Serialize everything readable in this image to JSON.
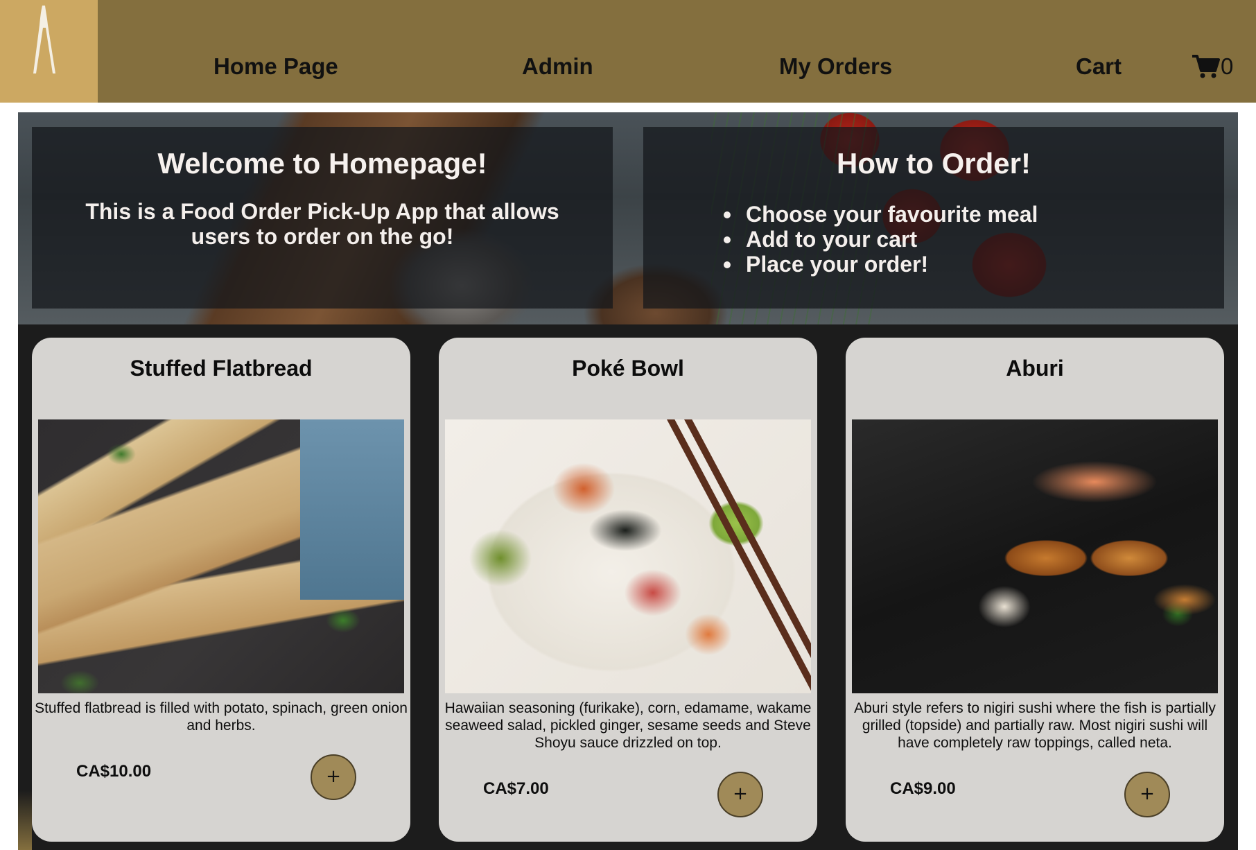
{
  "nav": {
    "logo_icon": "chopsticks-icon",
    "links": [
      {
        "label": "Home Page"
      },
      {
        "label": "Admin"
      },
      {
        "label": "My Orders"
      },
      {
        "label": "Cart"
      }
    ],
    "cart_icon": "cart-icon",
    "cart_count": "0",
    "colors": {
      "bar": "#846f3e",
      "logo_bg": "#cca862"
    }
  },
  "hero": {
    "welcome": {
      "title": "Welcome to Homepage!",
      "text": "This is a Food Order Pick-Up App that allows users to order on the go!"
    },
    "how_to": {
      "title": "How to Order!",
      "steps": [
        "Choose your favourite meal",
        "Add to your cart",
        "Place your order!"
      ]
    }
  },
  "products": [
    {
      "name": "Stuffed Flatbread",
      "description": "Stuffed flatbread is filled with potato, spinach, green onion and herbs.",
      "price": "CA$10.00",
      "add_label": "+"
    },
    {
      "name": "Poké Bowl",
      "description": "Hawaiian seasoning (furikake), corn, edamame, wakame seaweed salad, pickled ginger, sesame seeds and Steve Shoyu sauce drizzled on top.",
      "price": "CA$7.00",
      "add_label": "+"
    },
    {
      "name": "Aburi",
      "description": "Aburi style refers to nigiri sushi where the fish is partially grilled (topside) and partially raw. Most nigiri sushi will have completely raw toppings, called neta.",
      "price": "CA$9.00",
      "add_label": "+"
    }
  ]
}
